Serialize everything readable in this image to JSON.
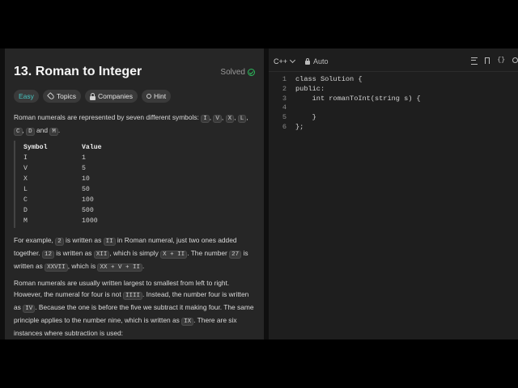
{
  "problem": {
    "title": "13. Roman to Integer",
    "status": "Solved",
    "chips": {
      "difficulty": "Easy",
      "topics": "Topics",
      "companies": "Companies",
      "hint": "Hint"
    },
    "intro": [
      "Roman numerals are represented by seven different symbols: ",
      "I",
      ", ",
      "V",
      ", ",
      "X",
      ", ",
      "L",
      ", ",
      "C",
      ", ",
      "D",
      " and ",
      "M",
      "."
    ],
    "table": {
      "headers": [
        "Symbol",
        "Value"
      ],
      "rows": [
        [
          "I",
          "1"
        ],
        [
          "V",
          "5"
        ],
        [
          "X",
          "10"
        ],
        [
          "L",
          "50"
        ],
        [
          "C",
          "100"
        ],
        [
          "D",
          "500"
        ],
        [
          "M",
          "1000"
        ]
      ]
    },
    "para2": [
      "For example, ",
      "2",
      " is written as ",
      "II",
      " in Roman numeral, just two ones added together. ",
      "12",
      " is written as ",
      "XII",
      ", which is simply ",
      "X + II",
      ". The number ",
      "27",
      " is written as ",
      "XXVII",
      ", which is ",
      "XX + V + II",
      "."
    ],
    "para3": [
      "Roman numerals are usually written largest to smallest from left to right. However, the numeral for four is not ",
      "IIII",
      ". Instead, the number four is written as ",
      "IV",
      ". Because the one is before the five we subtract it making four. The same principle applies to the number nine, which is written as ",
      "IX",
      ". There are six instances where subtraction is used:"
    ]
  },
  "editor": {
    "language": "C++",
    "mode": "Auto",
    "lines": [
      {
        "n": "1",
        "text": "class Solution {"
      },
      {
        "n": "2",
        "text": "public:"
      },
      {
        "n": "3",
        "text": "    int romanToInt(string s) {"
      },
      {
        "n": "4",
        "text": ""
      },
      {
        "n": "5",
        "text": "    }"
      },
      {
        "n": "6",
        "text": "};"
      }
    ]
  },
  "icons": [
    "check-circle-icon",
    "tag-icon",
    "lock-icon",
    "lightbulb-icon",
    "chevron-down-icon",
    "lock-icon",
    "format-icon",
    "bookmark-icon",
    "braces-icon",
    "reset-icon"
  ]
}
